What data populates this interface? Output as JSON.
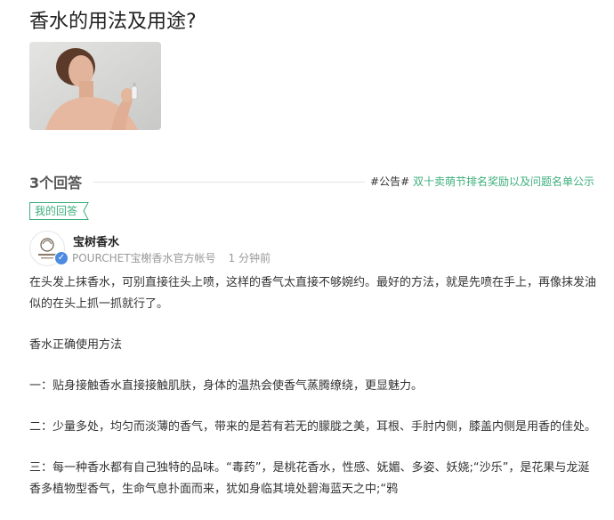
{
  "question": {
    "title": "香水的用法及用途?"
  },
  "answers_header": {
    "count_label": "3个回答",
    "notice_tag": "#公告#",
    "notice_text": "双十卖萌节排名奖励以及问题名单公示"
  },
  "my_answer_tag": "我的回答",
  "answer": {
    "author_name": "宝树香水",
    "author_desc": "POURCHET宝榭香水官方帐号",
    "time": "1 分钟前",
    "paragraphs": [
      "在头发上抹香水，可别直接往头上喷，这样的香气太直接不够婉约。最好的方法，就是先喷在手上，再像抹发油似的在头上抓一抓就行了。",
      "香水正确使用方法",
      "一：贴身接触香水直接接触肌肤，身体的温热会使香气蒸腾缭绕，更显魅力。",
      "二：少量多处，均匀而淡薄的香气，带来的是若有若无的朦胧之美，耳根、手肘内侧，膝盖内侧是用香的佳处。",
      "三：每一种香水都有自己独特的品味。“毒药”，是桃花香水，性感、妩媚、多姿、妖娆;“沙乐”，是花果与龙涎香多植物型香气，生命气息扑面而来，犹如身临其境处碧海蓝天之中;“鸦"
    ]
  },
  "colors": {
    "accent": "#3eaf7c",
    "muted": "#999999",
    "text": "#333333",
    "verify": "#4c8be0"
  }
}
